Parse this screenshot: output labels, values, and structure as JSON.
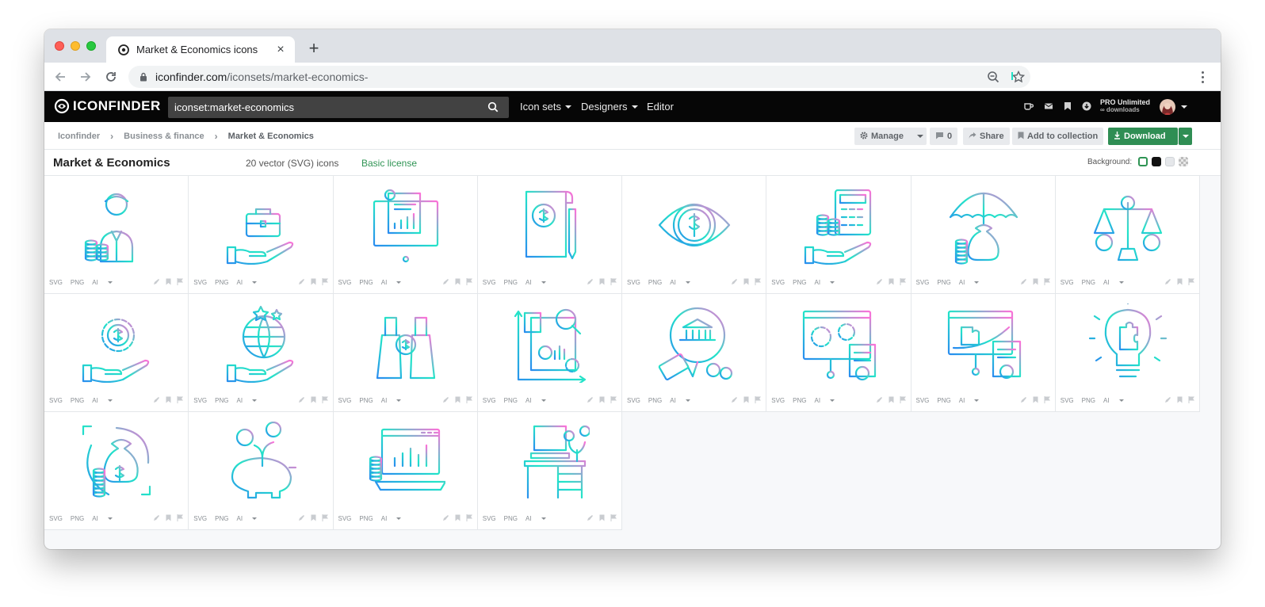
{
  "browser": {
    "tab_title": "Market & Economics icons",
    "url_host": "iconfinder.com",
    "url_path": "/iconsets/market-economics-"
  },
  "site": {
    "logo_text": "ICONFINDER",
    "search_value": "iconset:market-economics",
    "nav": {
      "icon_sets": "Icon sets",
      "designers": "Designers",
      "editor": "Editor"
    },
    "plan_title": "PRO Unlimited",
    "plan_sub": "∞ downloads"
  },
  "breadcrumb": {
    "items": [
      "Iconfinder",
      "Business & finance",
      "Market & Economics"
    ]
  },
  "actions": {
    "manage": "Manage",
    "comments_count": "0",
    "share": "Share",
    "add_to_collection": "Add to collection",
    "download": "Download"
  },
  "iconset": {
    "title": "Market & Economics",
    "count": "20 vector (SVG) icons",
    "license": "Basic license",
    "background_label": "Background:"
  },
  "formats": [
    "SVG",
    "PNG",
    "AI"
  ],
  "icons": [
    {
      "subject": "businessman-coins"
    },
    {
      "subject": "hand-briefcase"
    },
    {
      "subject": "presentation-report"
    },
    {
      "subject": "document-magnifier-dollar"
    },
    {
      "subject": "eye-dollar"
    },
    {
      "subject": "hand-calculator-coins"
    },
    {
      "subject": "umbrella-money-bag"
    },
    {
      "subject": "balance-scale-currency"
    },
    {
      "subject": "hand-gear-dollar"
    },
    {
      "subject": "hand-globe-stars"
    },
    {
      "subject": "binoculars-dollar"
    },
    {
      "subject": "analytics-chart"
    },
    {
      "subject": "bank-location-card"
    },
    {
      "subject": "board-gears-checklist"
    },
    {
      "subject": "board-puzzle-checklist"
    },
    {
      "subject": "lightbulb-puzzle"
    },
    {
      "subject": "money-bag-focus"
    },
    {
      "subject": "piggy-bank-plant"
    },
    {
      "subject": "laptop-chart-coins"
    },
    {
      "subject": "desk-computer-plant"
    }
  ],
  "colors": {
    "gradient_start": "#2a8cf0",
    "gradient_mid": "#22e5c8",
    "gradient_end": "#ff6fd8",
    "download_green": "#2f8e54",
    "license_green": "#2f9454"
  }
}
